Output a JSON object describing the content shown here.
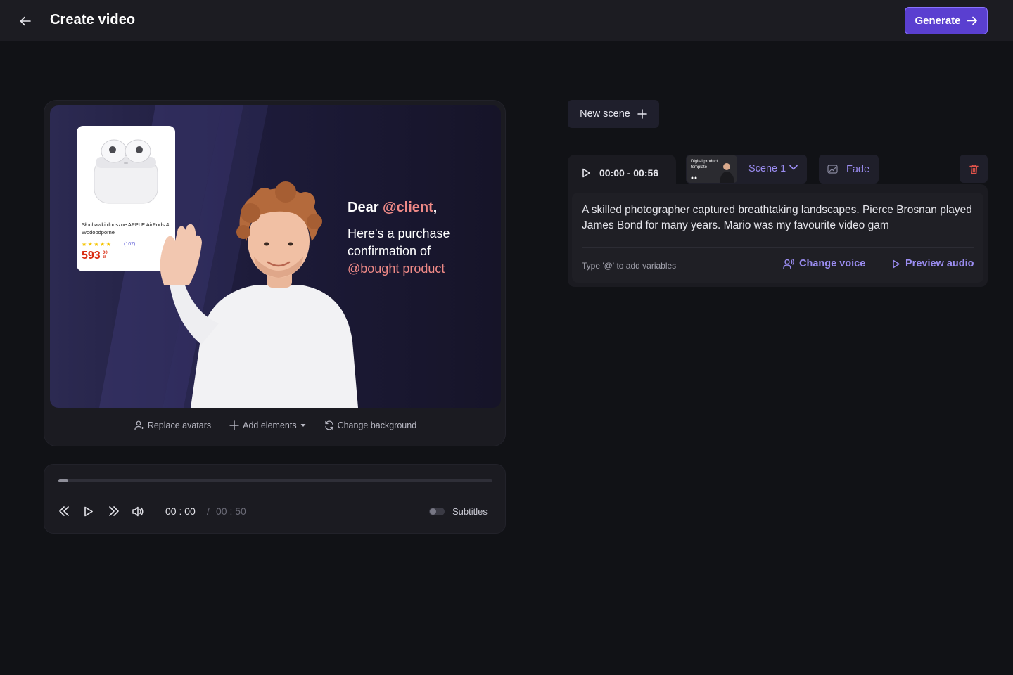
{
  "header": {
    "title": "Create video",
    "generate_label": "Generate"
  },
  "preview": {
    "product": {
      "name": "Słuchawki douszne APPLE AirPods 4 Wodoodporne",
      "stars": "★★★★★",
      "reviews": "(107)",
      "price_main": "593",
      "price_cents": "00",
      "price_currency": "zł"
    },
    "greeting_prefix": "Dear ",
    "greeting_var": "@client",
    "greeting_suffix": ",",
    "message": "Here's a purchase confirmation of",
    "message_var": "@bought product",
    "tools": {
      "replace_avatars": "Replace avatars",
      "add_elements": "Add elements",
      "change_background": "Change background"
    }
  },
  "player": {
    "progress": 0.022,
    "current_time": "00 : 00",
    "separator": "/",
    "total_time": "00 : 50",
    "subtitles_label": "Subtitles",
    "subtitles_on": false
  },
  "scenes": {
    "new_scene_label": "New scene",
    "active": {
      "time_range": "00:00 - 00:56",
      "thumbnail_label": "Digital product template",
      "name": "Scene 1",
      "transition": "Fade",
      "script": "A skilled photographer captured breathtaking landscapes. Pierce Brosnan played James Bond for many years. Mario was my favourite video gam",
      "hint": "Type '@' to add variables",
      "change_voice_label": "Change voice",
      "preview_audio_label": "Preview audio"
    }
  },
  "colors": {
    "accent": "#5a3fd0",
    "accent_text": "#9a8cf0",
    "variable": "#f08a87",
    "delete": "#e0534a",
    "background": "#111216",
    "panel": "#1b1b21"
  }
}
